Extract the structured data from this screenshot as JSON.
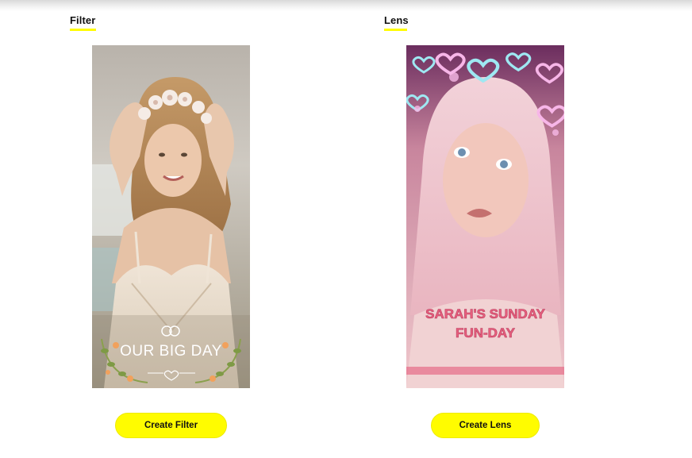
{
  "filter": {
    "section_label": "Filter",
    "overlay_text": "OUR BIG DAY",
    "button_label": "Create Filter"
  },
  "lens": {
    "section_label": "Lens",
    "overlay_line1": "SARAH'S SUNDAY",
    "overlay_line2": "FUN-DAY",
    "button_label": "Create Lens"
  },
  "colors": {
    "accent": "#fffc00",
    "filter_text": "#ffffff",
    "lens_text": "#e8607e"
  }
}
